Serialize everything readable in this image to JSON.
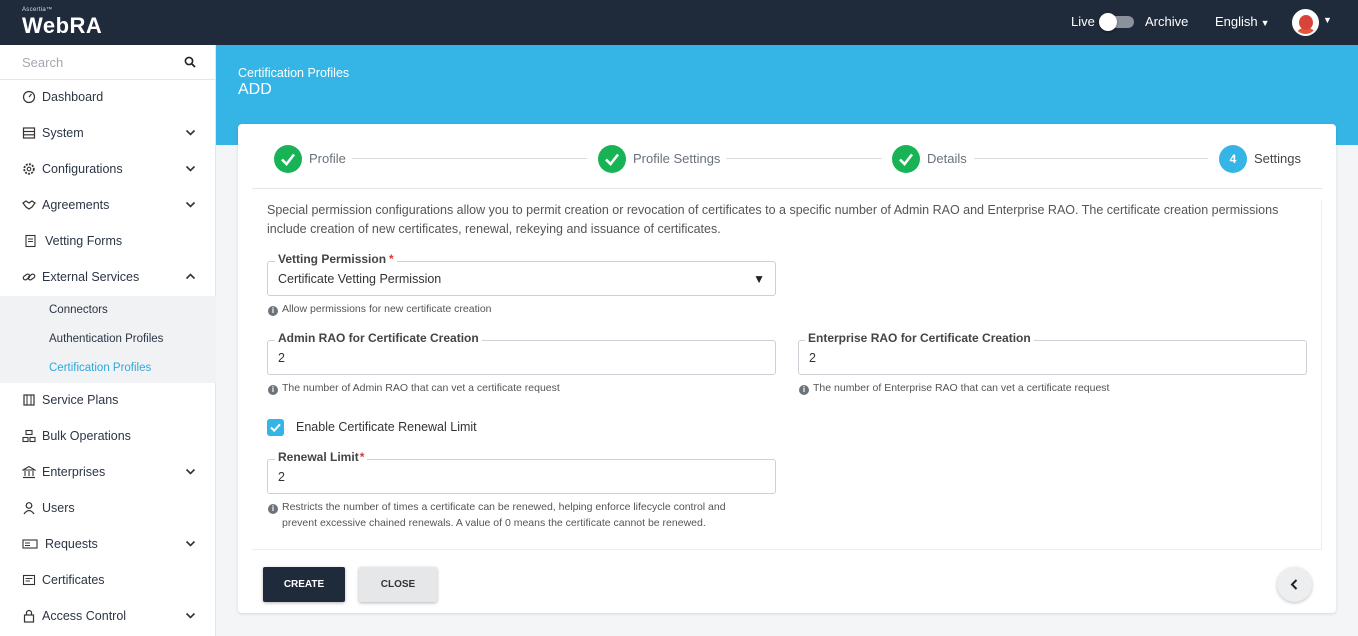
{
  "header": {
    "logo_small": "Ascertia™",
    "logo_big": "WebRA",
    "live_label": "Live",
    "archive_label": "Archive",
    "language": "English"
  },
  "sidebar": {
    "search_placeholder": "Search",
    "items": [
      {
        "label": "Dashboard",
        "icon": "dashboard-icon"
      },
      {
        "label": "System",
        "icon": "system-icon"
      },
      {
        "label": "Configurations",
        "icon": "gear-icon"
      },
      {
        "label": "Agreements",
        "icon": "handshake-icon"
      },
      {
        "label": "Vetting Forms",
        "icon": "form-icon"
      },
      {
        "label": "External Services",
        "icon": "link-icon"
      },
      {
        "label": "Service Plans",
        "icon": "service-plans-icon"
      },
      {
        "label": "Bulk Operations",
        "icon": "bulk-operations-icon"
      },
      {
        "label": "Enterprises",
        "icon": "bank-icon"
      },
      {
        "label": "Users",
        "icon": "user-icon"
      },
      {
        "label": "Requests",
        "icon": "requests-icon"
      },
      {
        "label": "Certificates",
        "icon": "certificate-icon"
      },
      {
        "label": "Access Control",
        "icon": "lock-icon"
      }
    ],
    "sub_items": [
      {
        "label": "Connectors"
      },
      {
        "label": "Authentication Profiles"
      },
      {
        "label": "Certification Profiles"
      }
    ]
  },
  "page": {
    "breadcrumb": "Certification Profiles",
    "title": "ADD"
  },
  "stepper": {
    "steps": [
      {
        "label": "Profile",
        "state": "done"
      },
      {
        "label": "Profile Settings",
        "state": "done"
      },
      {
        "label": "Details",
        "state": "done"
      },
      {
        "label": "Settings",
        "state": "active",
        "number": "4"
      }
    ]
  },
  "form": {
    "intro": "Special permission configurations allow you to permit creation or revocation of certificates to a specific number of Admin RAO and Enterprise RAO. The certificate creation permissions include creation of new certificates, renewal, rekeying and issuance of certificates.",
    "vetting_permission": {
      "label": "Vetting Permission",
      "required": "*",
      "value": "Certificate Vetting Permission",
      "hint": "Allow permissions for new certificate creation"
    },
    "admin_rao": {
      "label": "Admin RAO for Certificate Creation",
      "value": "2",
      "hint": "The number of Admin RAO that can vet a certificate request"
    },
    "enterprise_rao": {
      "label": "Enterprise RAO for Certificate Creation",
      "value": "2",
      "hint": "The number of Enterprise RAO that can vet a certificate request"
    },
    "renewal_checkbox": {
      "label": "Enable Certificate Renewal Limit",
      "checked": true
    },
    "renewal_limit": {
      "label": "Renewal Limit",
      "required": "*",
      "value": "2",
      "hint_line1": "Restricts the number of times a certificate can be renewed, helping enforce lifecycle control and",
      "hint_line2": "prevent excessive chained renewals. A value of 0 means the certificate cannot be renewed."
    }
  },
  "actions": {
    "create_label": "CREATE",
    "close_label": "CLOSE"
  },
  "colors": {
    "topbar": "#1f2a3a",
    "banner": "#35b5e5",
    "step_done": "#17b355",
    "accent": "#35b5e5"
  }
}
